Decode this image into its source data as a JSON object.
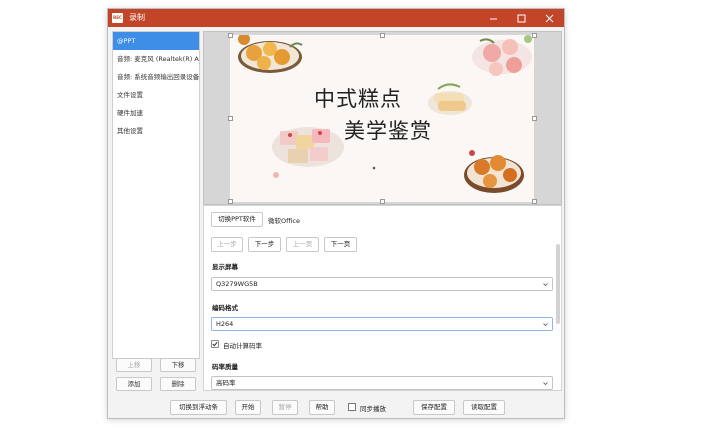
{
  "window": {
    "title": "录制",
    "app_icon_text": "REC"
  },
  "sidebar": {
    "items": [
      {
        "label": "@PPT",
        "active": true
      },
      {
        "label": "音频: 麦克风 (Realtek(R) Au"
      },
      {
        "label": "音频: 系统音频输出回录设备"
      },
      {
        "label": "文件设置"
      },
      {
        "label": "硬件加速"
      },
      {
        "label": "其他设置"
      }
    ],
    "move_up": "上移",
    "move_down": "下移",
    "add": "添加",
    "remove": "删除"
  },
  "slide": {
    "line1": "中式糕点",
    "line2": "美学鉴赏"
  },
  "panel": {
    "switch_ppt_software": "切换PPT软件",
    "office_label": "微软Office",
    "prev_step": "上一步",
    "next_step": "下一步",
    "prev_page": "上一页",
    "next_page": "下一页",
    "display_label": "显示屏幕",
    "display_value": "Q3279WG5B",
    "encoding_label": "编码格式",
    "encoding_value": "H264",
    "auto_bitrate_label": "自动计算码率",
    "auto_bitrate_checked": true,
    "quality_label": "码率质量",
    "quality_value": "高码率"
  },
  "bottom": {
    "switch_float": "切换到浮动条",
    "start": "开始",
    "pause": "暂停",
    "help": "帮助",
    "sync_play": "同步播放",
    "save_config": "保存配置",
    "load_config": "读取配置"
  },
  "colors": {
    "titlebar": "#c2452a",
    "active_item": "#3e8ee8",
    "select_focus": "#3e8ee8"
  }
}
